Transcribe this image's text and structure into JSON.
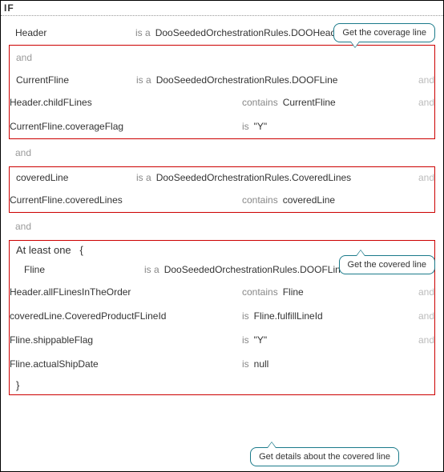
{
  "header": {
    "if_label": "IF"
  },
  "rule": {
    "header_row": {
      "subject": "Header",
      "op": "is a",
      "value": "DooSeededOrchestrationRules.DOOHeader"
    },
    "and1": "and",
    "block1": {
      "row": {
        "subject": "CurrentFline",
        "op": "is a",
        "value": "DooSeededOrchestrationRules.DOOFLine",
        "trail": "and"
      },
      "attrs": [
        {
          "name": "Header.childFLines",
          "op": "contains",
          "value": "CurrentFline",
          "trail": "and"
        },
        {
          "name": "CurrentFline.coverageFlag",
          "op": "is",
          "value": "\"Y\"",
          "trail": ""
        }
      ]
    },
    "and2": "and",
    "block2": {
      "row": {
        "subject": "coveredLine",
        "op": "is a",
        "value": "DooSeededOrchestrationRules.CoveredLines",
        "trail": "and"
      },
      "attrs": [
        {
          "name": "CurrentFline.coveredLines",
          "op": "contains",
          "value": "coveredLine",
          "trail": ""
        }
      ]
    },
    "and3": "and",
    "block3": {
      "prefix": "At least one",
      "brace_open": "{",
      "row": {
        "subject": "Fline",
        "op": "is a",
        "value": "DooSeededOrchestrationRules.DOOFLine",
        "trail": "and"
      },
      "attrs": [
        {
          "name": "Header.allFLinesInTheOrder",
          "op": "contains",
          "value": "Fline",
          "trail": "and"
        },
        {
          "name": "coveredLine.CoveredProductFLineId",
          "op": "is",
          "value": "Fline.fulfillLineId",
          "trail": "and"
        },
        {
          "name": "Fline.shippableFlag",
          "op": "is",
          "value": "\"Y\"",
          "trail": "and"
        },
        {
          "name": "Fline.actualShipDate",
          "op": "is",
          "value": "null",
          "trail": ""
        }
      ],
      "brace_close": "}"
    }
  },
  "callouts": {
    "c1": "Get the coverage line",
    "c2": "Get the covered line",
    "c3": "Get details about the covered line"
  }
}
